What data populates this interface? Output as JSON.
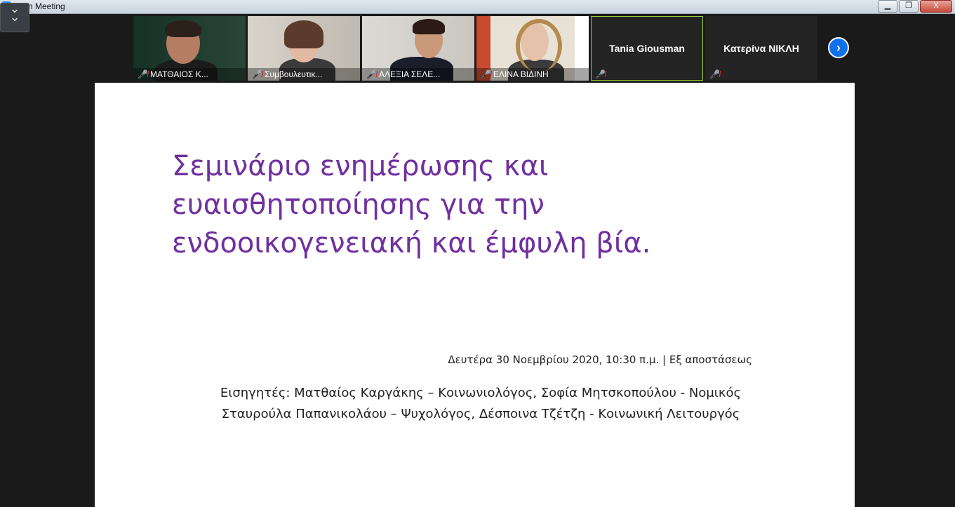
{
  "window": {
    "title": "Zoom Meeting",
    "minimize_icon": "minimize-icon",
    "restore_icon": "restore-icon",
    "close_label": "X"
  },
  "participants": [
    {
      "name": "ΜΑΤΘΑΙΟΣ Κ...",
      "muted": true,
      "video": true
    },
    {
      "name": "Συμβουλευτικ...",
      "muted": true,
      "video": true
    },
    {
      "name": "ΑΛΕΞΙΑ ΣΕΛΕ...",
      "muted": true,
      "video": true
    },
    {
      "name": "ΕΛΙΝΑ ΒΙΔΙΝΗ",
      "muted": true,
      "video": true
    },
    {
      "name": "Tania Giousman",
      "muted": true,
      "video": false,
      "active_speaker": true
    },
    {
      "name": "Κατερίνα ΝΙΚΛΗ",
      "muted": true,
      "video": false
    }
  ],
  "slide": {
    "title_lines": [
      "Σεμινάριο ενημέρωσης και",
      "ευαισθητοποίησης για την",
      "ενδοοικογενειακή και έμφυλη βία."
    ],
    "date_line": "Δευτέρα 30 Νοεμβρίου 2020,  10:30 π.μ. | Εξ αποστάσεως",
    "speakers_line1": "Εισηγητές: Ματθαίος Καργάκης – Κοινωνιολόγος,  Σοφία Μητσκοπούλου - Νομικός",
    "speakers_line2": "Σταυρούλα Παπανικολάου – Ψυχολόγος,  Δέσποινα Τζέτζη - Κοινωνική Λειτουργός"
  },
  "colors": {
    "title_purple": "#7030a0",
    "zoom_blue": "#0e71eb",
    "muted_red": "#e0282a",
    "active_speaker_border": "#9acd32"
  }
}
